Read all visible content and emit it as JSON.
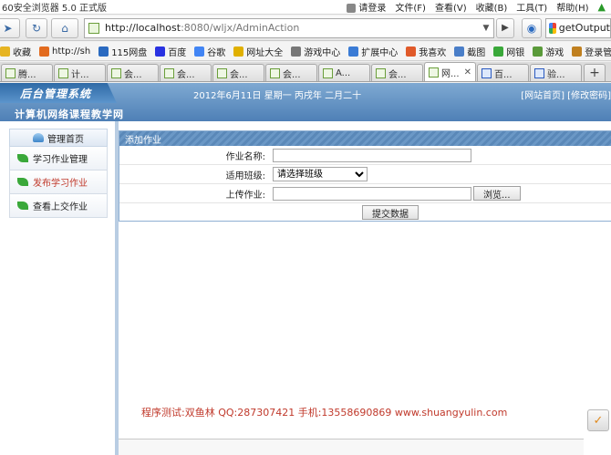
{
  "browser": {
    "app_title": "60安全浏览器 5.0 正式版",
    "menu": {
      "login": "请登录",
      "file": "文件(F)",
      "view": "查看(V)",
      "favorites": "收藏(B)",
      "tools": "工具(T)",
      "help": "帮助(H)"
    },
    "address": {
      "host": "http://localhost",
      "rest": ":8080/wljx/AdminAction"
    },
    "search_text": "getOutput",
    "bookmarks": [
      {
        "label": "收藏",
        "icon": "star-icon",
        "color": "#e6b422"
      },
      {
        "label": "http://sh",
        "icon": "site-icon",
        "color": "#e26b1f"
      },
      {
        "label": "115网盘",
        "icon": "cloud-icon",
        "color": "#2a6ac0"
      },
      {
        "label": "百度",
        "icon": "baidu-icon",
        "color": "#2932e1"
      },
      {
        "label": "谷歌",
        "icon": "google-icon",
        "color": "#4285f4"
      },
      {
        "label": "网址大全",
        "icon": "globe-icon",
        "color": "#e0b000"
      },
      {
        "label": "游戏中心",
        "icon": "gamepad-icon",
        "color": "#777777"
      },
      {
        "label": "扩展中心",
        "icon": "puzzle-icon",
        "color": "#3a7bd5"
      },
      {
        "label": "我喜欢",
        "icon": "heart-icon",
        "color": "#e05a2a"
      },
      {
        "label": "截图",
        "icon": "scissors-icon",
        "color": "#4a7ec8"
      },
      {
        "label": "网银",
        "icon": "bank-icon",
        "color": "#3aa83a"
      },
      {
        "label": "游戏",
        "icon": "gamepad-icon",
        "color": "#5a9a3a"
      },
      {
        "label": "登录管家",
        "icon": "key-icon",
        "color": "#c08020"
      }
    ],
    "tabs": [
      {
        "label": "腾..."
      },
      {
        "label": "计..."
      },
      {
        "label": "会..."
      },
      {
        "label": "会..."
      },
      {
        "label": "会..."
      },
      {
        "label": "会..."
      },
      {
        "label": "A..."
      },
      {
        "label": "会..."
      },
      {
        "label": "网..."
      },
      {
        "label": "百..."
      },
      {
        "label": "验..."
      }
    ],
    "active_tab_index": 8
  },
  "site": {
    "logo_text": "后台管理系统",
    "date_line": "2012年6月11日  星期一  丙戌年  二月二十",
    "top_links": "[网站首页] [修改密码]",
    "site_name": "计算机网络课程教学网",
    "sidebar": {
      "head": "管理首页",
      "items": [
        {
          "label": "学习作业管理"
        },
        {
          "label": "发布学习作业"
        },
        {
          "label": "查看上交作业"
        }
      ]
    },
    "form": {
      "title": "添加作业",
      "name_label": "作业名称:",
      "class_label": "适用班级:",
      "class_selected": "请选择班级",
      "upload_label": "上传作业:",
      "browse_label": "浏览...",
      "submit_label": "提交数据"
    },
    "footer_note": "程序测试:双鱼林 QQ:287307421 手机:13558690869 www.shuangyulin.com"
  }
}
